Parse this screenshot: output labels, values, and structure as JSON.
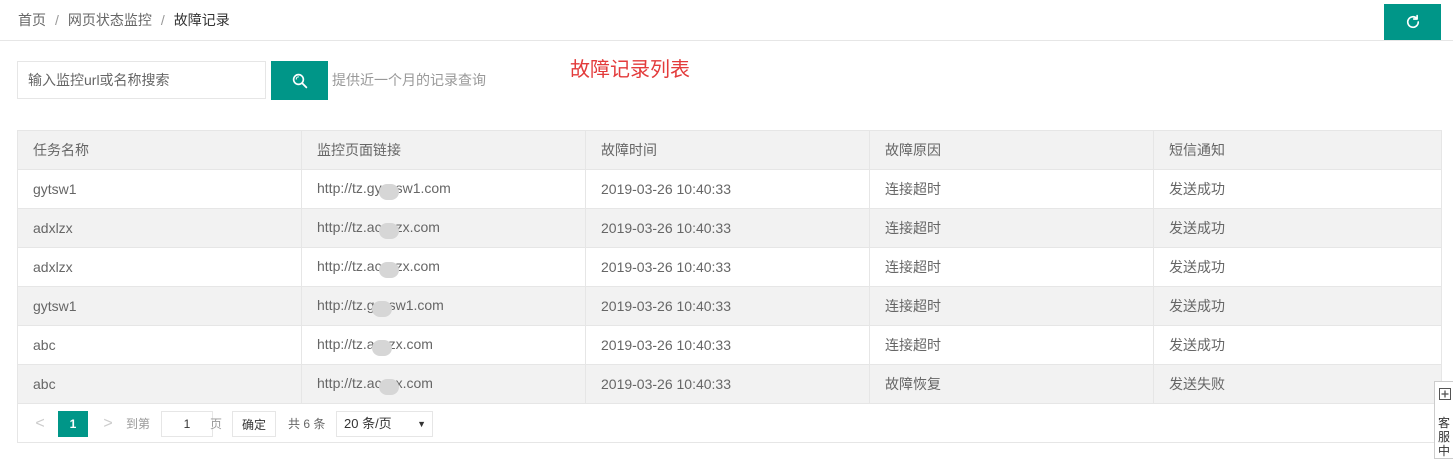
{
  "breadcrumb": {
    "home": "首页",
    "section": "网页状态监控",
    "current": "故障记录",
    "separator": "/"
  },
  "refresh_icon": "refresh-icon",
  "search": {
    "placeholder": "输入监控url或名称搜索",
    "value": "",
    "button_icon": "search-icon",
    "hint": "提供近一个月的记录查询"
  },
  "list_title": "故障记录列表",
  "colors": {
    "accent": "#009688",
    "title_red": "#e33b3b"
  },
  "table": {
    "headers": [
      "任务名称",
      "监控页面链接",
      "故障时间",
      "故障原因",
      "短信通知"
    ],
    "rows": [
      {
        "name": "gytsw1",
        "url_pre": "http://tz.gy",
        "url_post": "sw1.com",
        "time": "2019-03-26 10:40:33",
        "reason": "连接超时",
        "sms": "发送成功"
      },
      {
        "name": "adxlzx",
        "url_pre": "http://tz.ac",
        "url_post": "zx.com",
        "time": "2019-03-26 10:40:33",
        "reason": "连接超时",
        "sms": "发送成功"
      },
      {
        "name": "adxlzx",
        "url_pre": "http://tz.ac",
        "url_post": "zx.com",
        "time": "2019-03-26 10:40:33",
        "reason": "连接超时",
        "sms": "发送成功"
      },
      {
        "name": "gytsw1",
        "url_pre": "http://tz.g",
        "url_post": "sw1.com",
        "time": "2019-03-26 10:40:33",
        "reason": "连接超时",
        "sms": "发送成功"
      },
      {
        "name": "abc",
        "url_pre": "http://tz.a",
        "url_post": "zx.com",
        "time": "2019-03-26 10:40:33",
        "reason": "连接超时",
        "sms": "发送成功"
      },
      {
        "name": "abc",
        "url_pre": "http://tz.ac",
        "url_post": "x.com",
        "time": "2019-03-26 10:40:33",
        "reason": "故障恢复",
        "sms": "发送失败"
      }
    ]
  },
  "pager": {
    "prev": "<",
    "current": "1",
    "next": ">",
    "goto_label": "到第",
    "goto_value": "1",
    "page_label": "页",
    "confirm": "确定",
    "total": "共 6 条",
    "page_size": "20 条/页"
  },
  "side_widget": {
    "icon": "plus-box-icon",
    "label": "客服中"
  }
}
